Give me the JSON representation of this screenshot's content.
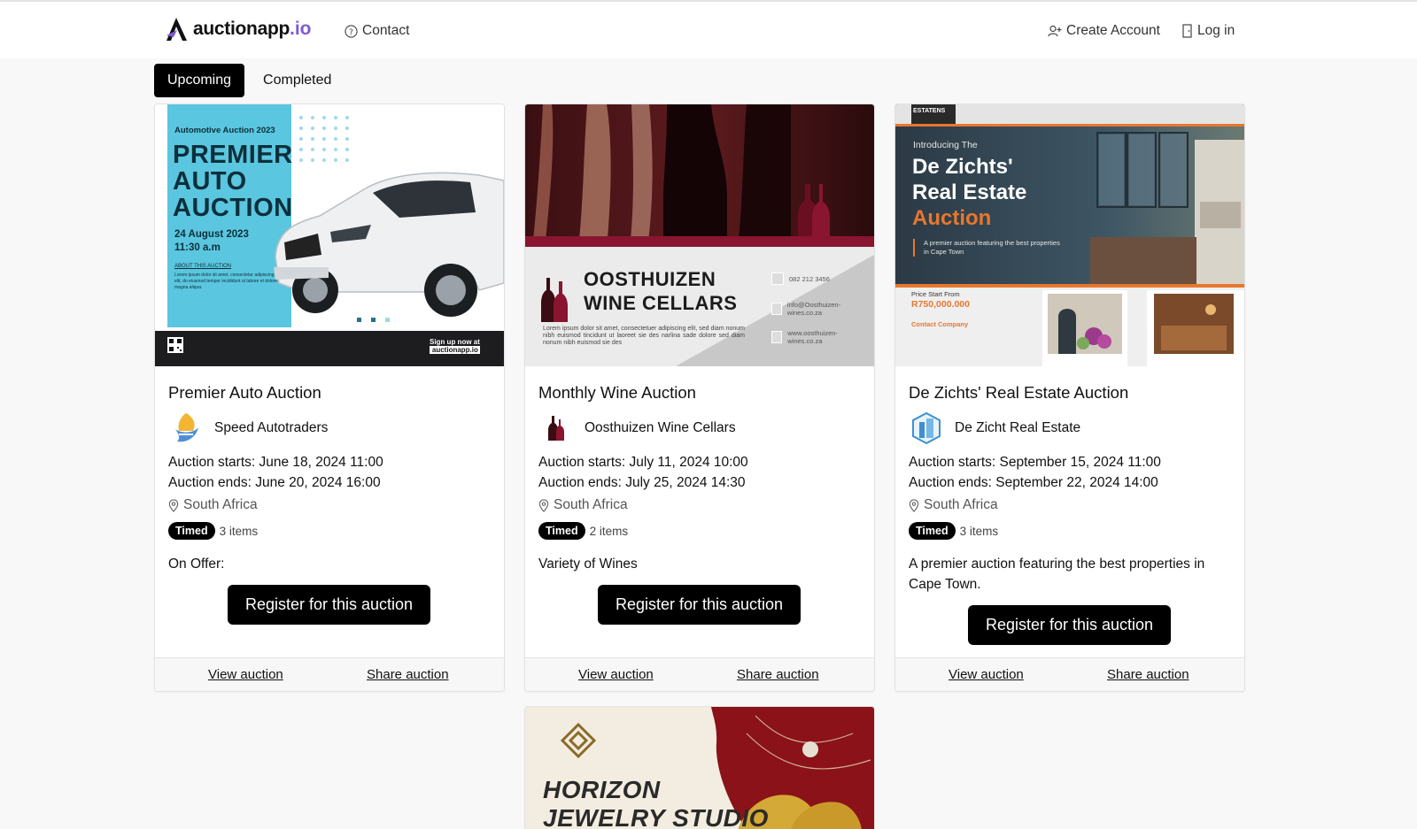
{
  "header": {
    "brand": "auctionapp",
    "brand_tld": ".io",
    "contact": "Contact",
    "create_account": "Create Account",
    "login": "Log in"
  },
  "tabs": [
    {
      "label": "Upcoming",
      "active": true
    },
    {
      "label": "Completed",
      "active": false
    }
  ],
  "auctions": [
    {
      "title": "Premier Auto Auction",
      "seller": "Speed Autotraders",
      "starts": "Auction starts: June 18, 2024 11:00",
      "ends": "Auction ends: June 20, 2024 16:00",
      "location": "South Africa",
      "type": "Timed",
      "items": "3 items",
      "description": "On Offer:",
      "register": "Register for this auction",
      "view": "View auction",
      "share": "Share auction",
      "poster": {
        "kicker": "Automotive Auction 2023",
        "headline": [
          "PREMIER",
          "AUTO",
          "AUCTION"
        ],
        "date": "24 August 2023",
        "time": "11:30 a.m",
        "about": "ABOUT THIS AUCTION",
        "body": "Lorem ipsum dolor sit amet, consectetur adipiscing elit, do eiusmod tempor incididunt ut labore et dolore magna aliqua.",
        "signup": "Sign up now at",
        "site": "auctionapp.io"
      }
    },
    {
      "title": "Monthly Wine Auction",
      "seller": "Oosthuizen Wine Cellars",
      "starts": "Auction starts: July 11, 2024 10:00",
      "ends": "Auction ends: July 25, 2024 14:30",
      "location": "South Africa",
      "type": "Timed",
      "items": "2 items",
      "description": "Variety of Wines",
      "register": "Register for this auction",
      "view": "View auction",
      "share": "Share auction",
      "poster": {
        "headline": [
          "OOSTHUIZEN",
          "WINE CELLARS"
        ],
        "body": "Lorem ipsum dolor sit amet, consectetuer adipiscing elit, sed diam nonum nibh euismod tincidunt ut laoreet sie des narlina sade dolore sed diam nonum nibh euismod sie des",
        "phone": "082 212 3456",
        "email": "info@Oosthuizen-wines.co.za",
        "web": "www.oosthuizen-wines.co.za"
      }
    },
    {
      "title": "De Zichts' Real Estate Auction",
      "seller": "De Zicht Real Estate",
      "starts": "Auction starts: September 15, 2024 11:00",
      "ends": "Auction ends: September 22, 2024 14:00",
      "location": "South Africa",
      "type": "Timed",
      "items": "3 items",
      "description": "A premier auction featuring the best properties in Cape Town.",
      "register": "Register for this auction",
      "view": "View auction",
      "share": "Share auction",
      "poster": {
        "brand": "ESTATENS",
        "intro": "Introducing The",
        "headline": [
          "De Zichts'",
          "Real Estate"
        ],
        "headline_accent": "Auction",
        "tagline": "A premier auction featuring the best properties in Cape Town",
        "price_label": "Price Start From",
        "price": "R750,000.000",
        "contact": "Contact Company"
      }
    }
  ],
  "partial_card": {
    "headline": [
      "HORIZON",
      "JEWELRY STUDIO"
    ]
  },
  "colors": {
    "accent": "#7b5cd6",
    "poster_blue": "#5bc6df",
    "wine": "#8a1530",
    "orange": "#e8772e"
  }
}
